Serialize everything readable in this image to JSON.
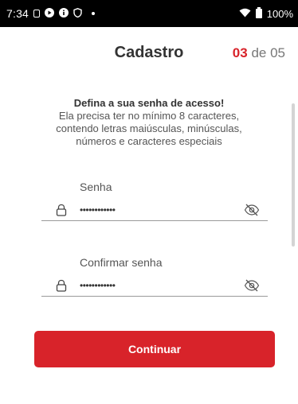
{
  "status_bar": {
    "time": "7:34",
    "battery_percent": "100%",
    "icons": [
      "sim-icon",
      "play-icon",
      "info-icon",
      "shield-icon",
      "dot-icon",
      "wifi-icon",
      "battery-icon"
    ]
  },
  "header": {
    "title": "Cadastro",
    "step_current": "03",
    "step_separator": " de ",
    "step_total": "05"
  },
  "intro": {
    "title": "Defina a sua senha de acesso!",
    "line1": "Ela precisa ter no mínimo 8 caracteres,",
    "line2": "contendo letras maiúsculas, minúsculas,",
    "line3": "números e caracteres especiais"
  },
  "password_field": {
    "label": "Senha",
    "value": "••••••••••••",
    "icon": "lock-icon",
    "toggle_icon": "eye-off-icon"
  },
  "confirm_password_field": {
    "label": "Confirmar senha",
    "value": "••••••••••••",
    "icon": "lock-icon",
    "toggle_icon": "eye-off-icon"
  },
  "continue_button": {
    "label": "Continuar"
  },
  "colors": {
    "accent": "#d8232a",
    "text_dark": "#333333",
    "text_muted": "#555555",
    "status_bar": "#000000"
  }
}
